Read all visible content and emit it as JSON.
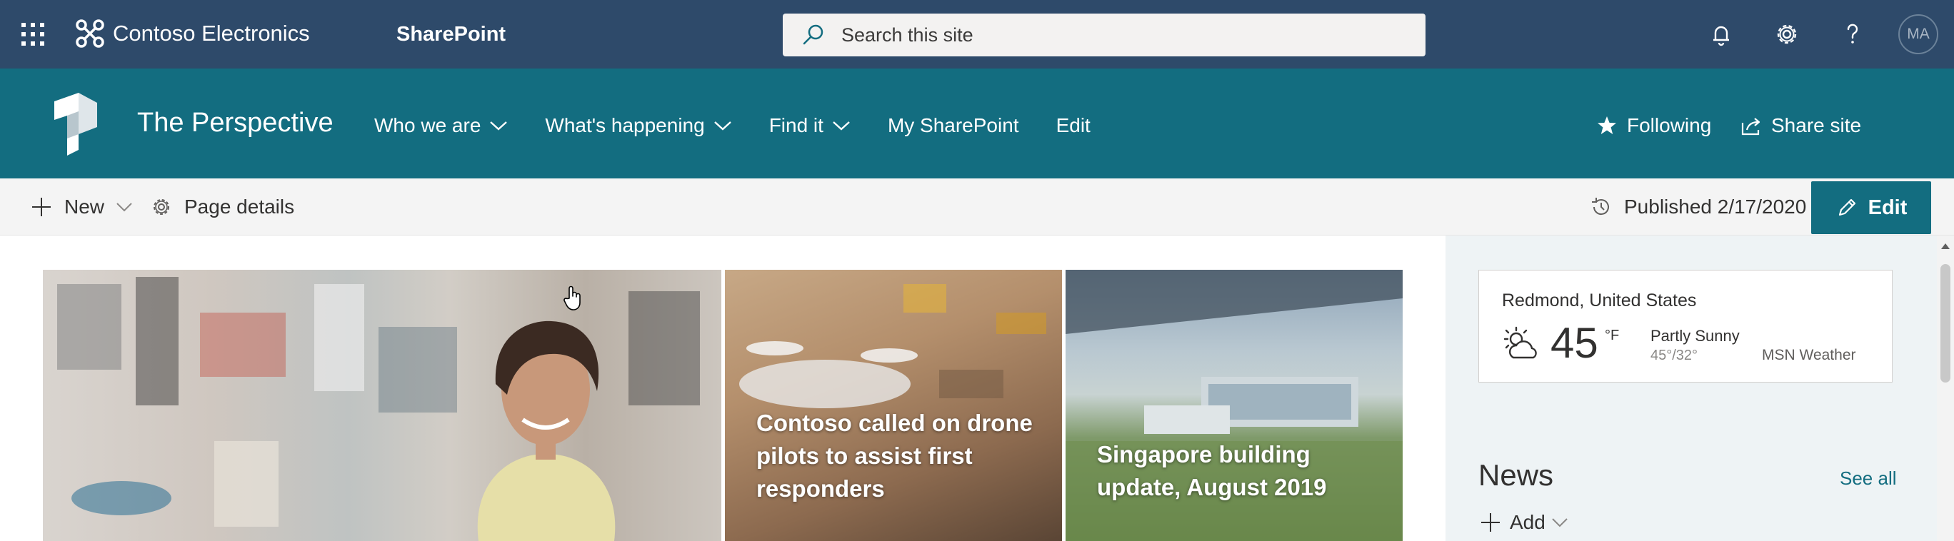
{
  "suite_bar": {
    "brand_name": "Contoso Electronics",
    "app_name": "SharePoint",
    "search_placeholder": "Search this site",
    "avatar_initials": "MA",
    "icons": [
      "waffle-icon",
      "contoso-logo-icon",
      "search-icon",
      "bell-icon",
      "gear-icon",
      "help-icon"
    ]
  },
  "site_header": {
    "site_title": "The Perspective",
    "nav": [
      {
        "label": "Who we are",
        "has_dropdown": true
      },
      {
        "label": "What's happening",
        "has_dropdown": true
      },
      {
        "label": "Find it",
        "has_dropdown": true
      },
      {
        "label": "My SharePoint",
        "has_dropdown": false
      },
      {
        "label": "Edit",
        "has_dropdown": false
      }
    ],
    "following_label": "Following",
    "share_label": "Share site"
  },
  "command_bar": {
    "new_label": "New",
    "page_details_label": "Page details",
    "published_label": "Published 2/17/2020",
    "edit_label": "Edit"
  },
  "hero": {
    "tiles": [
      {
        "title": ""
      },
      {
        "title": "Contoso called on drone pilots to assist first responders"
      },
      {
        "title": "Singapore building update, August 2019"
      }
    ]
  },
  "weather": {
    "location": "Redmond, United States",
    "temperature": "45",
    "unit": "°F",
    "condition": "Partly Sunny",
    "range": "45°/32°",
    "source": "MSN Weather"
  },
  "news": {
    "title": "News",
    "see_all_label": "See all",
    "add_label": "Add"
  },
  "colors": {
    "suite_bar_bg": "#2e4a6a",
    "site_header_bg": "#136d80",
    "accent": "#136d80",
    "command_bar_bg": "#f4f4f4",
    "rail_bg": "#eef3f5"
  }
}
